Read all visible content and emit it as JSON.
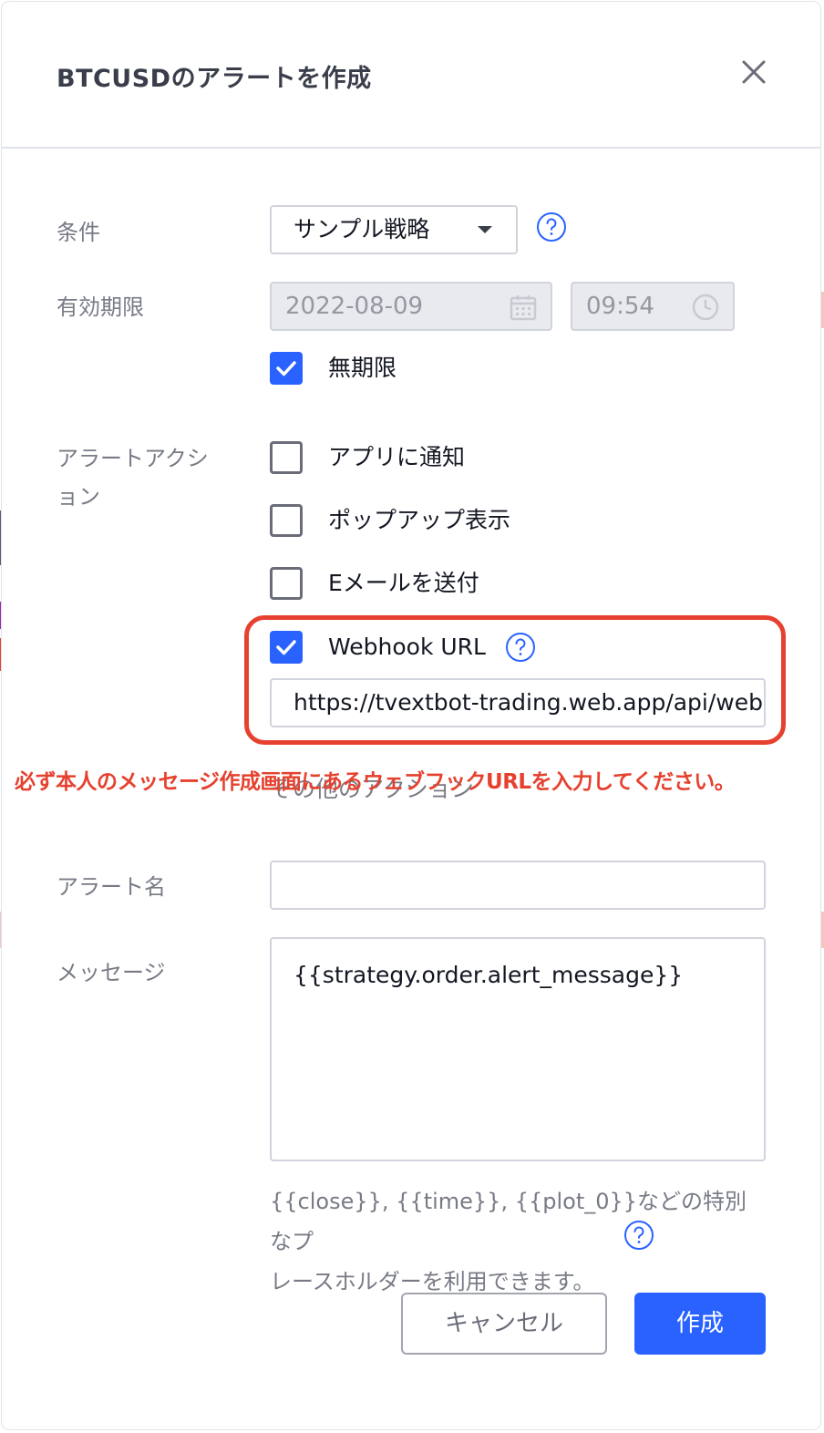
{
  "dialog": {
    "title": "BTCUSDのアラートを作成"
  },
  "condition": {
    "label": "条件",
    "selected": "サンプル戦略"
  },
  "expiration": {
    "label": "有効期限",
    "date": "2022-08-09",
    "time": "09:54",
    "unlimited_label": "無期限",
    "unlimited_checked": true
  },
  "alert_actions": {
    "label_line1": "アラートアクシ",
    "label_line2": "ョン",
    "items": [
      {
        "label": "アプリに通知",
        "checked": false
      },
      {
        "label": "ポップアップ表示",
        "checked": false
      },
      {
        "label": "Eメールを送付",
        "checked": false
      },
      {
        "label": "Webhook URL",
        "checked": true
      }
    ],
    "webhook_url": "https://tvextbot-trading.web.app/api/web",
    "other_actions_label": "その他のアクション"
  },
  "annotation": {
    "text": "必ず本人のメッセージ作成画面にあるウェブフックURLを入力してください。",
    "color": "#e6412f"
  },
  "alert_name": {
    "label": "アラート名",
    "value": ""
  },
  "message": {
    "label": "メッセージ",
    "value": "{{strategy.order.alert_message}}",
    "hint_line1": "{{close}}, {{time}}, {{plot_0}}などの特別なプ",
    "hint_line2": "レースホルダーを利用できます。"
  },
  "buttons": {
    "cancel": "キャンセル",
    "create": "作成"
  },
  "colors": {
    "accent": "#2962ff",
    "highlight": "#e6412f"
  },
  "icons": [
    "close-icon",
    "help-icon",
    "calendar-icon",
    "clock-icon",
    "check-icon",
    "caret-down-icon"
  ]
}
